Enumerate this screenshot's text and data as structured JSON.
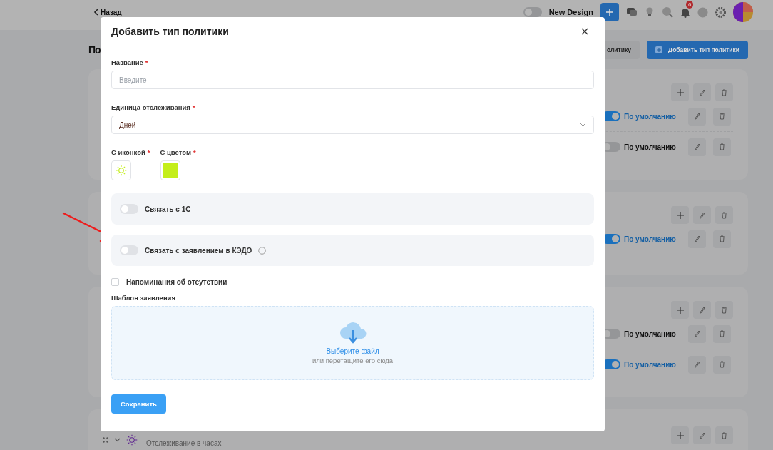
{
  "topbar": {
    "back_link": "Назад",
    "new_design": {
      "label": "New Design",
      "on": false
    },
    "notifications_count": "6"
  },
  "page": {
    "title": "По",
    "buttons": [
      {
        "label": "олитику",
        "kind": "secondary"
      },
      {
        "label": "Добавить тип политики",
        "kind": "primary"
      }
    ]
  },
  "policy_cards": [
    {
      "rows": [
        {
          "label": "По умолчанию",
          "on": true
        },
        {
          "label": "По умолчанию",
          "on": false
        }
      ]
    },
    {
      "rows": [
        {
          "label": "По умолчанию",
          "on": true
        }
      ]
    },
    {
      "rows": [
        {
          "label": "По умолчанию",
          "on": false
        },
        {
          "label": "По умолчанию",
          "on": true
        }
      ]
    },
    {
      "subtitle": "Отслеживание в часах"
    }
  ],
  "modal": {
    "title": "Добавить тип политики",
    "name_field": {
      "label": "Название",
      "required_mark": "*",
      "placeholder": "Введите"
    },
    "unit_field": {
      "label": "Единица отслеживания",
      "required_mark": "*",
      "value": "Дней"
    },
    "icon_field": {
      "label": "С иконкой",
      "required_mark": "*"
    },
    "color_field": {
      "label": "С цветом",
      "required_mark": "*",
      "color": "#c4ee1a"
    },
    "toggles": [
      {
        "label": "Связать с 1С",
        "on": false,
        "info": false
      },
      {
        "label": "Связать с заявлением в КЭДО",
        "on": false,
        "info": true
      }
    ],
    "reminder": {
      "label": "Напоминания об отсутствии",
      "checked": false
    },
    "template": {
      "label": "Шаблон заявления",
      "link": "Выберите файл",
      "hint": "или перетащите его сюда"
    },
    "save_button": "Сохранить"
  }
}
